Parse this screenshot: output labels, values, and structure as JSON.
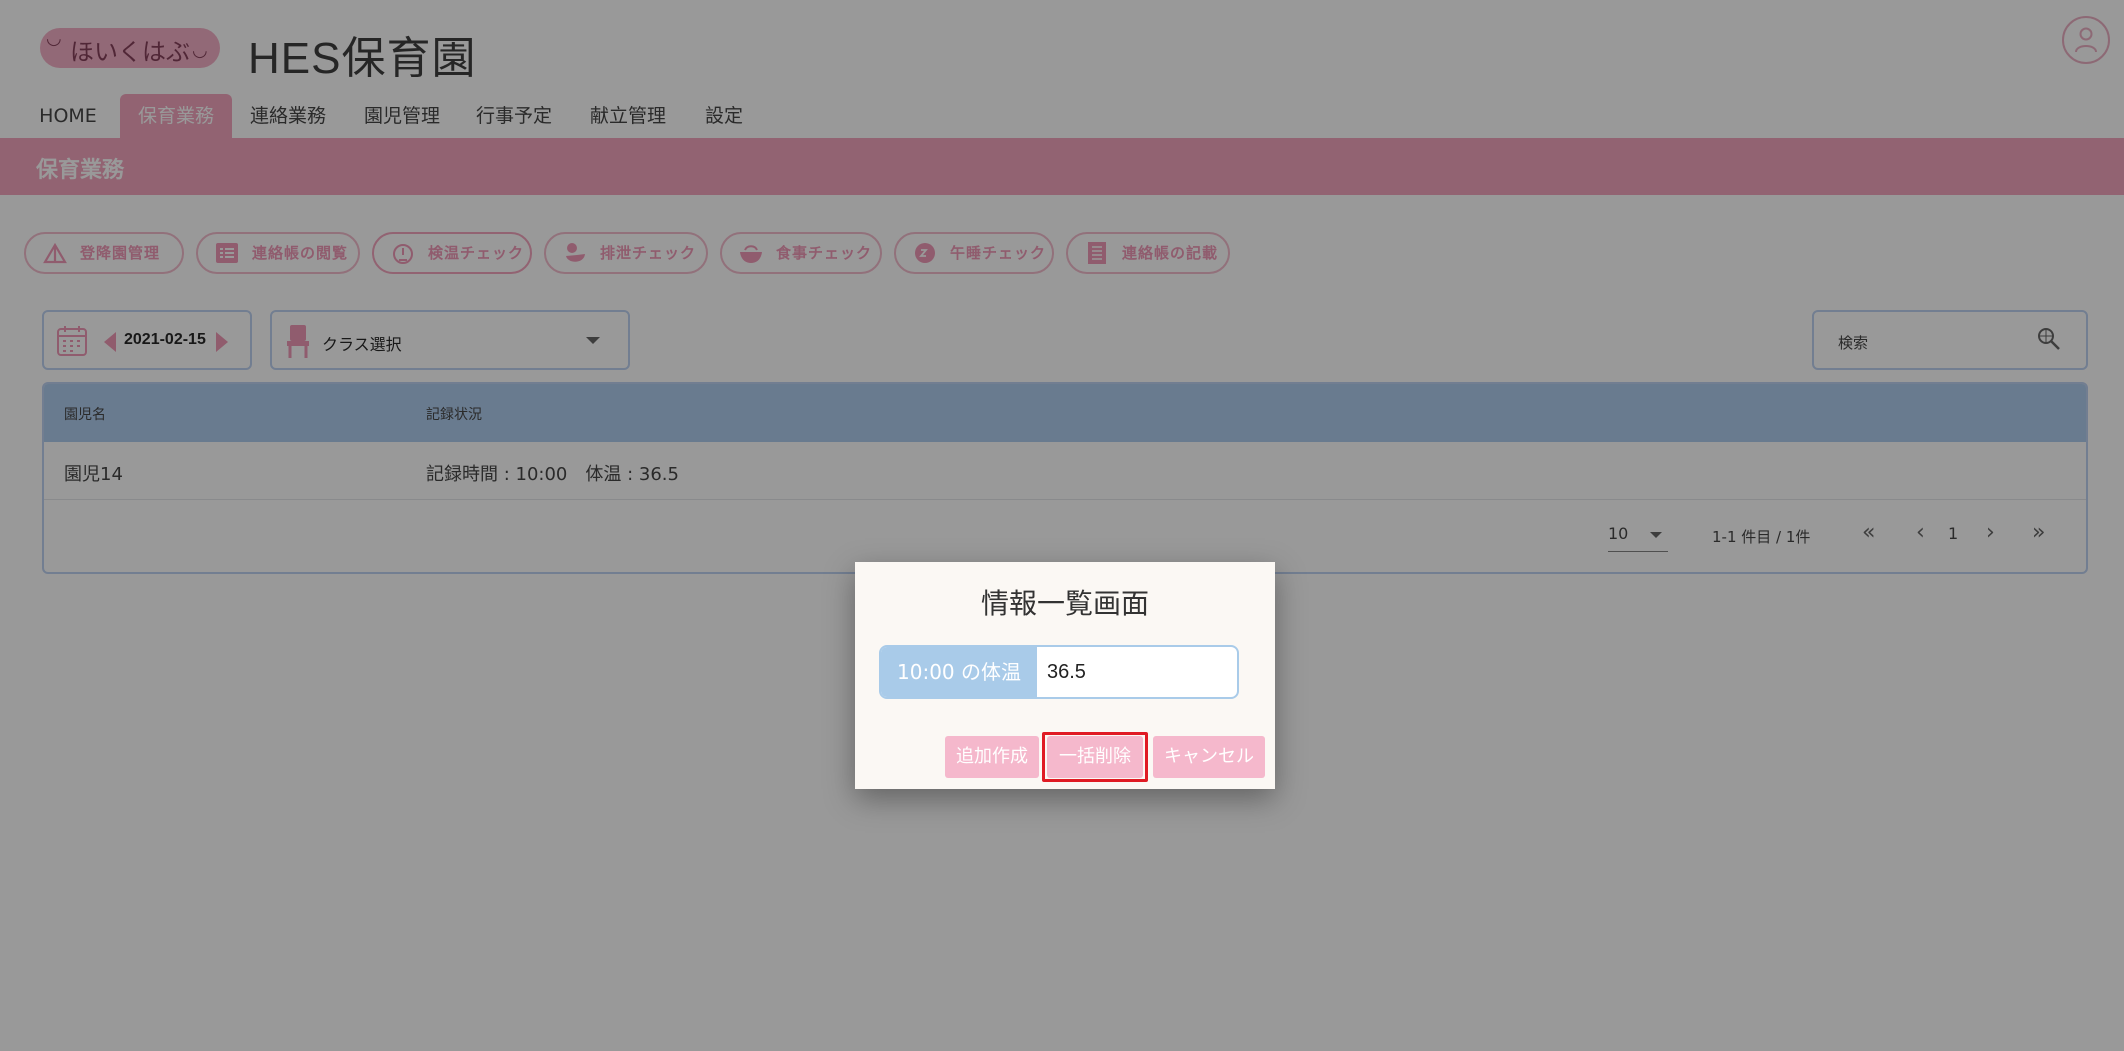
{
  "header": {
    "logo_text": "ほいくはぶ",
    "site_title": "HES保育園"
  },
  "nav": {
    "items": [
      {
        "label": "HOME"
      },
      {
        "label": "保育業務",
        "active": true
      },
      {
        "label": "連絡業務"
      },
      {
        "label": "園児管理"
      },
      {
        "label": "行事予定"
      },
      {
        "label": "献立管理"
      },
      {
        "label": "設定"
      }
    ]
  },
  "section": {
    "title": "保育業務"
  },
  "tools": [
    {
      "label": "登降園管理",
      "icon": "tent-icon"
    },
    {
      "label": "連絡帳の閲覧",
      "icon": "list-icon"
    },
    {
      "label": "検温チェック",
      "icon": "thermometer-icon",
      "active": true
    },
    {
      "label": "排泄チェック",
      "icon": "duck-icon"
    },
    {
      "label": "食事チェック",
      "icon": "bowl-icon"
    },
    {
      "label": "午睡チェック",
      "icon": "sleep-icon"
    },
    {
      "label": "連絡帳の記載",
      "icon": "notebook-icon"
    }
  ],
  "filters": {
    "date": "2021-02-15",
    "class_select": "クラス選択",
    "search_placeholder": "検索"
  },
  "table": {
    "headers": [
      "園児名",
      "記録状況"
    ],
    "rows": [
      {
        "name": "園児14",
        "status": "記録時間 : 10:00　体温 : 36.5"
      }
    ]
  },
  "pagination": {
    "per_page": "10",
    "range": "1-1 件目 / 1件",
    "page": "1"
  },
  "modal": {
    "title": "情報一覧画面",
    "field_label": "10:00 の体温",
    "field_value": "36.5",
    "buttons": {
      "add": "追加作成",
      "delete_all": "一括削除",
      "cancel": "キャンセル"
    }
  },
  "colors": {
    "brand_pink": "#f29bb8",
    "table_header_blue": "#a7c8ec",
    "highlight_red": "#e01b24"
  }
}
